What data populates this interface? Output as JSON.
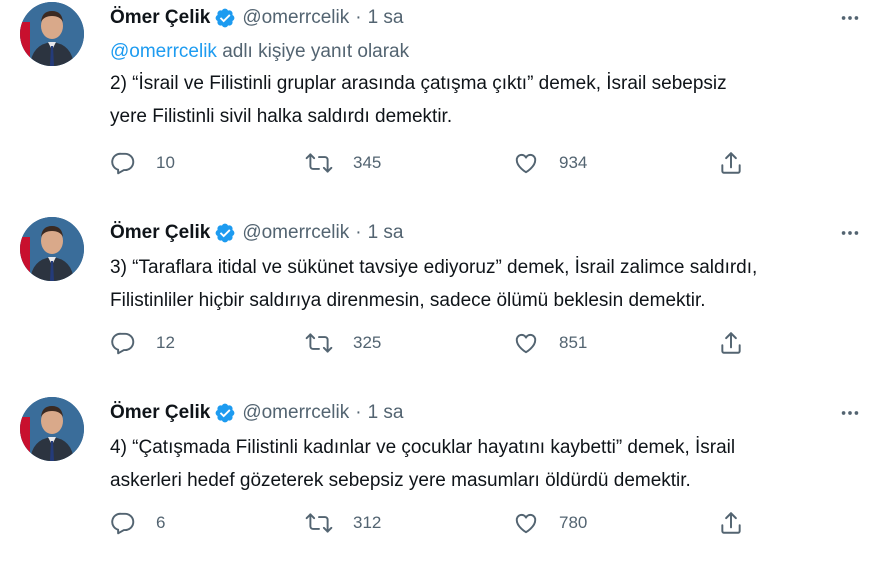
{
  "colors": {
    "accent": "#1d9bf0",
    "secondary_text": "#536471",
    "primary_text": "#0f1419"
  },
  "icons": {
    "verified": "verified-badge-icon",
    "more": "more-horizontal-icon",
    "reply": "reply-bubble-icon",
    "retweet": "retweet-icon",
    "like": "heart-icon",
    "share": "share-upload-icon"
  },
  "tweets": [
    {
      "author_name": "Ömer Çelik",
      "handle": "@omerrcelik",
      "separator": "·",
      "time": "1 sa",
      "reply_mention": "@omerrcelik",
      "reply_suffix": " adlı kişiye yanıt olarak",
      "text": "2) “İsrail ve Filistinli gruplar arasında çatışma çıktı” demek, İsrail sebepsiz\nyere Filistinli sivil halka saldırdı demektir.",
      "replies": "10",
      "retweets": "345",
      "likes": "934"
    },
    {
      "author_name": "Ömer Çelik",
      "handle": "@omerrcelik",
      "separator": "·",
      "time": "1 sa",
      "text": "3) “Taraflara itidal ve sükünet tavsiye ediyoruz” demek, İsrail zalimce saldırdı,\nFilistinliler hiçbir saldırıya direnmesin, sadece ölümü beklesin demektir.",
      "replies": "12",
      "retweets": "325",
      "likes": "851"
    },
    {
      "author_name": "Ömer Çelik",
      "handle": "@omerrcelik",
      "separator": "·",
      "time": "1 sa",
      "text": "4) “Çatışmada Filistinli kadınlar ve çocuklar hayatını kaybetti” demek, İsrail\naskerleri hedef gözeterek sebepsiz yere masumları öldürdü demektir.",
      "replies": "6",
      "retweets": "312",
      "likes": "780"
    }
  ]
}
